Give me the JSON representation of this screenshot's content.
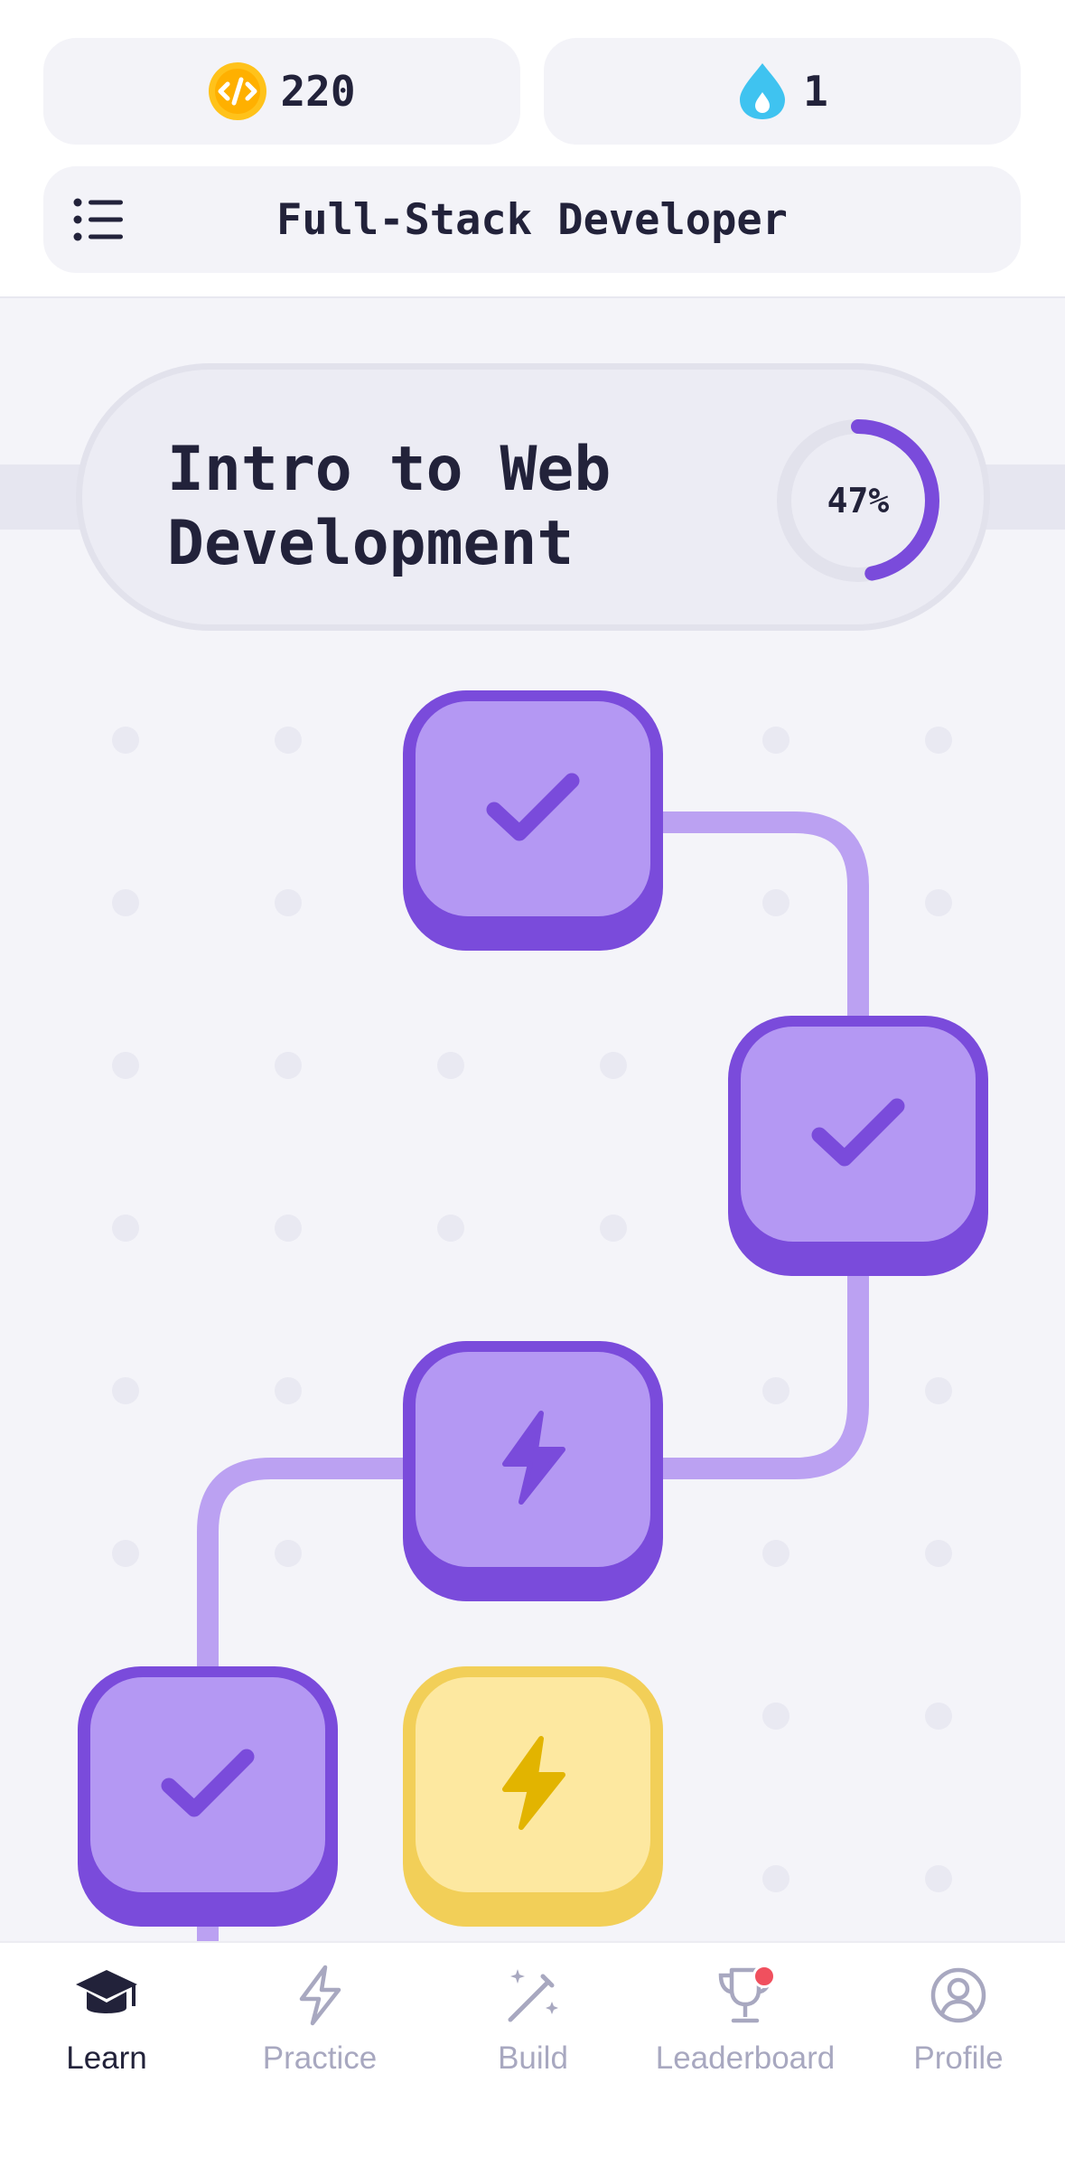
{
  "header": {
    "coins": {
      "value": "220",
      "icon": "coin-code-icon"
    },
    "streak": {
      "value": "1",
      "icon": "water-drop-icon"
    },
    "course": {
      "title": "Full-Stack Developer",
      "icon": "list-menu-icon"
    }
  },
  "unit": {
    "title_line1": "Intro to Web",
    "title_line2": "Development",
    "progress_label": "47%",
    "progress": 0.47
  },
  "lessons": [
    {
      "status": "completed",
      "icon": "check-icon",
      "color": "#b498f3"
    },
    {
      "status": "completed",
      "icon": "check-icon",
      "color": "#b498f3"
    },
    {
      "status": "completed-practice",
      "icon": "lightning-icon",
      "color": "#b498f3"
    },
    {
      "status": "completed",
      "icon": "check-icon",
      "color": "#b498f3"
    },
    {
      "status": "current",
      "icon": "lightning-icon",
      "color": "#fde8a0"
    }
  ],
  "nav": [
    {
      "label": "Learn",
      "icon": "graduation-cap-icon",
      "active": true
    },
    {
      "label": "Practice",
      "icon": "lightning-outline-icon",
      "active": false
    },
    {
      "label": "Build",
      "icon": "magic-wand-icon",
      "active": false
    },
    {
      "label": "Leaderboard",
      "icon": "trophy-icon",
      "active": false,
      "badge": true
    },
    {
      "label": "Profile",
      "icon": "profile-icon",
      "active": false
    }
  ],
  "colors": {
    "accent": "#7a4bdb",
    "accent_light": "#b498f3",
    "current": "#f2cf58",
    "text": "#22223a",
    "muted": "#a8a8c0",
    "badge": "#f0505e"
  }
}
